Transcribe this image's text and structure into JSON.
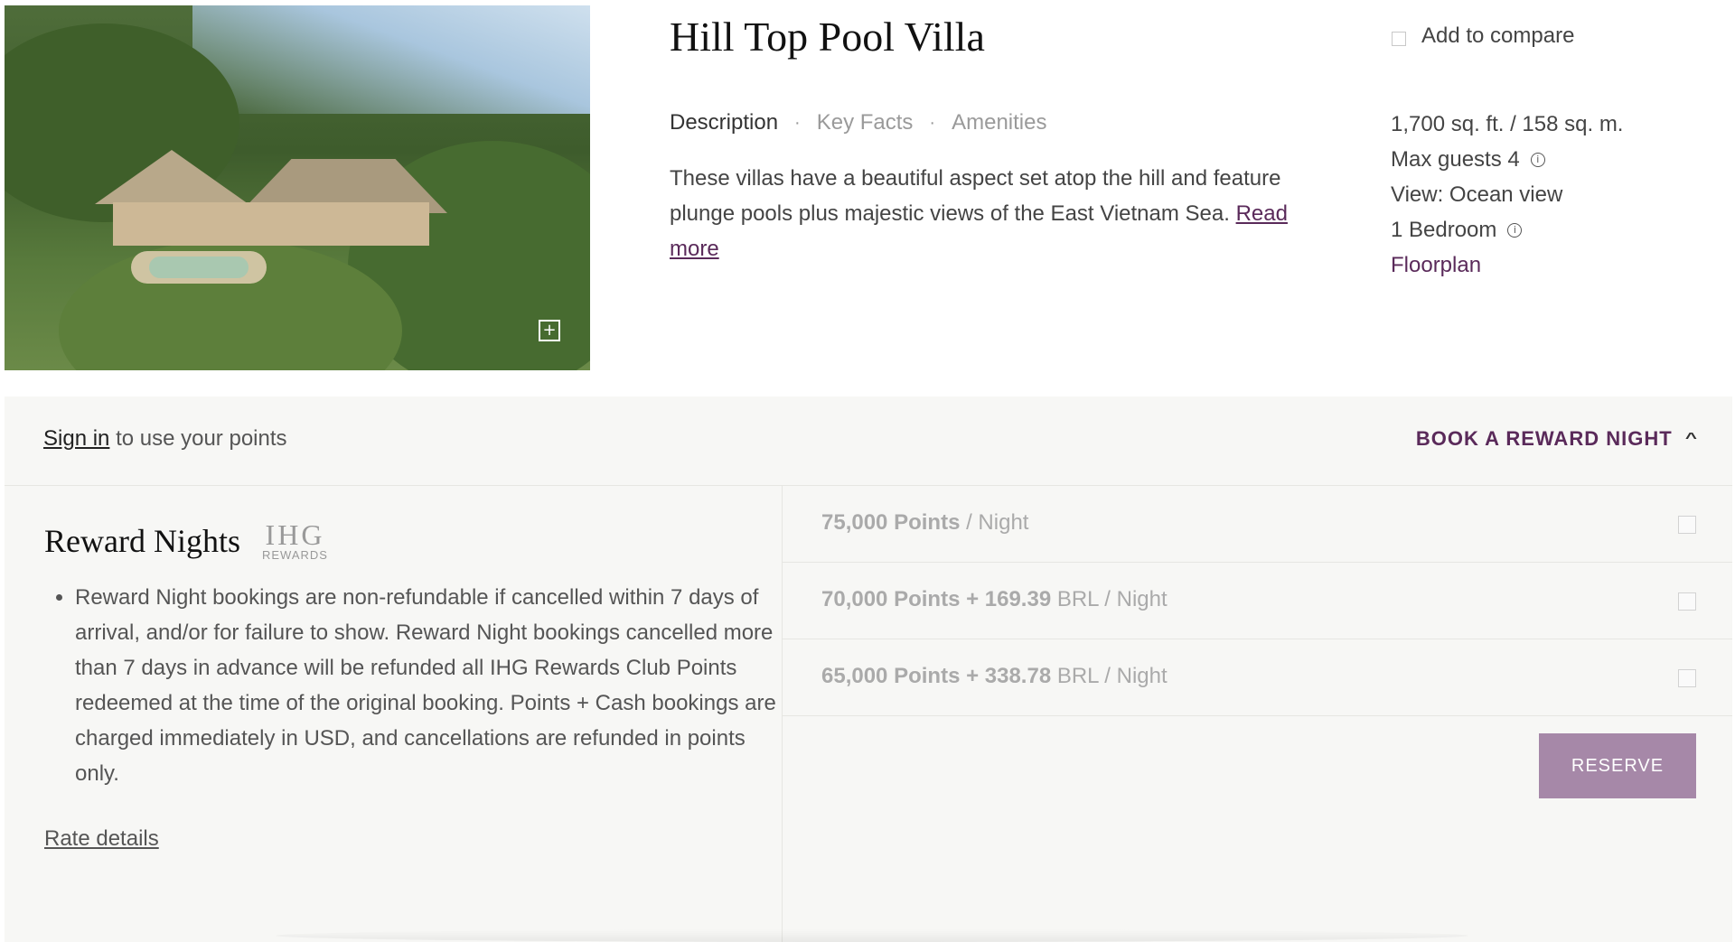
{
  "room": {
    "title": "Hill Top Pool Villa",
    "compare_label": "Add to compare",
    "tabs": [
      {
        "label": "Description"
      },
      {
        "label": "Key Facts"
      },
      {
        "label": "Amenities"
      }
    ],
    "description": "These villas have a beautiful aspect set atop the hill and feature plunge pools plus majestic views of the East Vietnam Sea.",
    "read_more": "Read more",
    "facts": {
      "size": "1,700 sq. ft. / 158 sq. m.",
      "guests": "Max guests 4",
      "view": "View: Ocean view",
      "bedroom": "1 Bedroom",
      "floorplan": "Floorplan"
    }
  },
  "reward": {
    "signin_link": "Sign in",
    "signin_text": "to use your points",
    "book_label": "BOOK A REWARD NIGHT",
    "title": "Reward Nights",
    "logo_big": "IHG",
    "logo_small": "REWARDS",
    "policy": "Reward Night bookings are non-refundable if cancelled within 7 days of arrival, and/or for failure to show. Reward Night bookings cancelled more than 7 days in advance will be refunded all IHG Rewards Club Points redeemed at the time of the original booking. Points + Cash bookings are charged immediately in USD, and cancellations are refunded in points only.",
    "rate_details": "Rate details",
    "rates": [
      {
        "bold": "75,000 Points",
        "rest": " / Night"
      },
      {
        "bold": "70,000 Points + 169.39",
        "rest": " BRL / Night"
      },
      {
        "bold": "65,000 Points + 338.78",
        "rest": " BRL / Night"
      }
    ],
    "reserve_label": "RESERVE"
  },
  "icons": {
    "zoom": "expand-icon",
    "info": "info-icon",
    "chevron": "chevron-up-icon"
  }
}
